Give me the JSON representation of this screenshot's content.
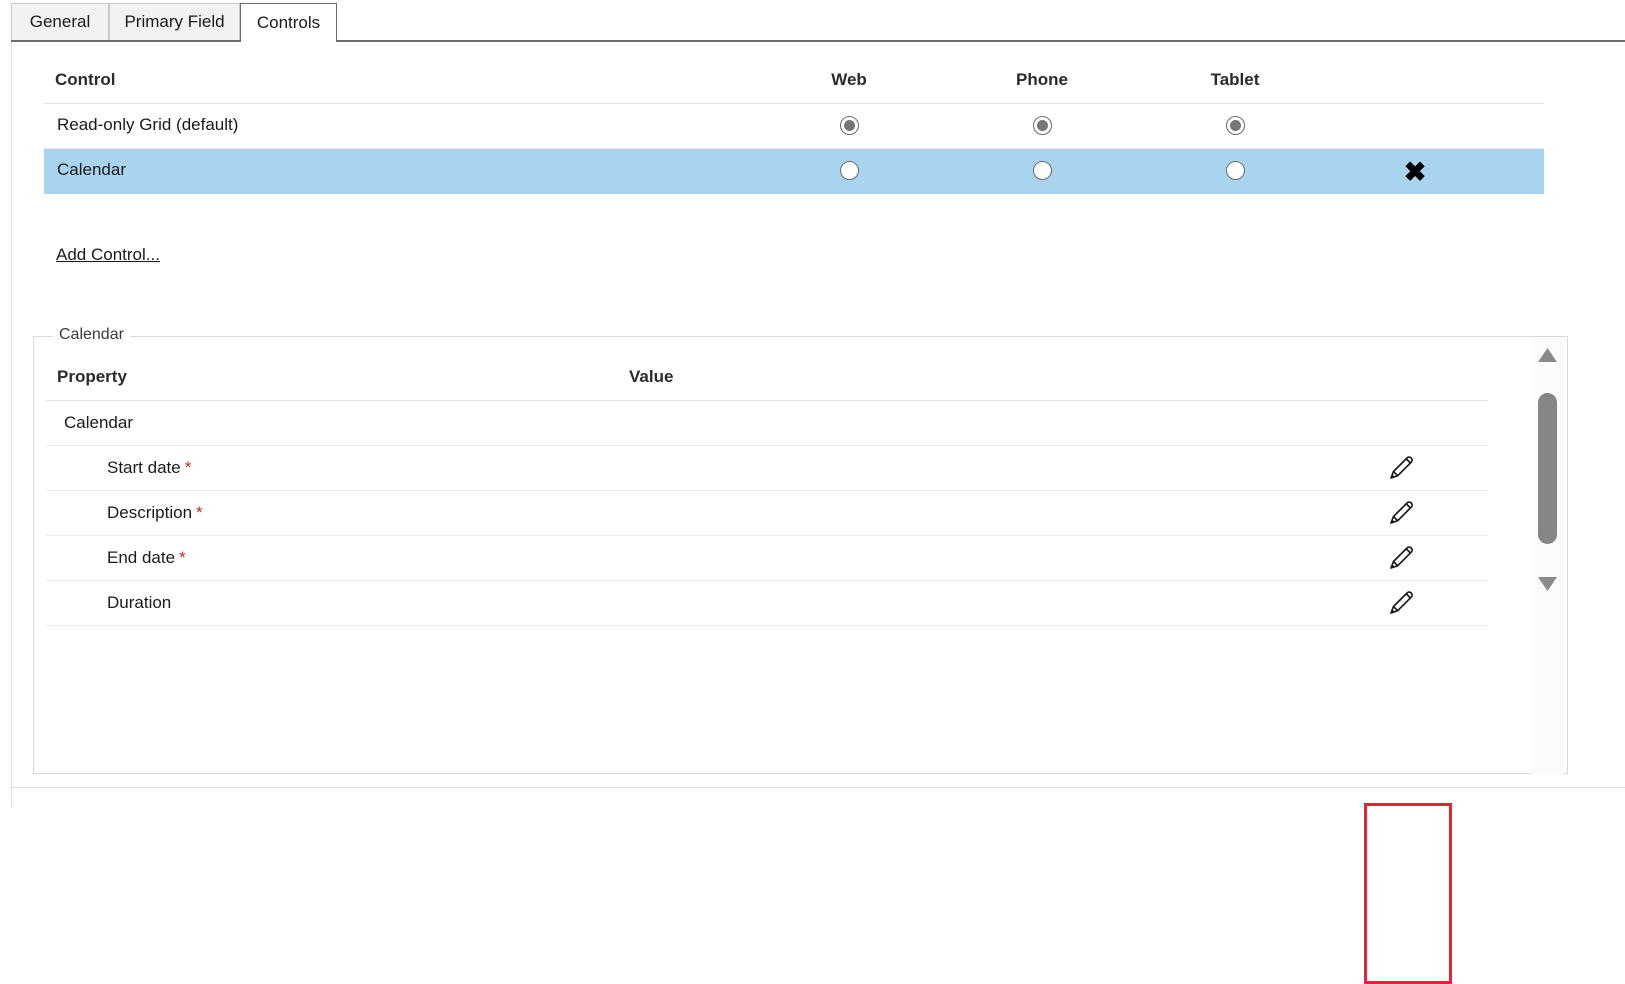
{
  "tabs": [
    {
      "label": "General",
      "active": false
    },
    {
      "label": "Primary Field",
      "active": false
    },
    {
      "label": "Controls",
      "active": true
    }
  ],
  "controls_table": {
    "headers": {
      "control": "Control",
      "web": "Web",
      "phone": "Phone",
      "tablet": "Tablet"
    },
    "rows": [
      {
        "name": "Read-only Grid (default)",
        "web_selected": true,
        "phone_selected": true,
        "tablet_selected": true,
        "highlighted": false,
        "deletable": false
      },
      {
        "name": "Calendar",
        "web_selected": false,
        "phone_selected": false,
        "tablet_selected": false,
        "highlighted": true,
        "deletable": true
      }
    ],
    "add_control_label": "Add Control...",
    "delete_icon": "close-x-icon"
  },
  "properties_panel": {
    "legend": "Calendar",
    "headers": {
      "property": "Property",
      "value": "Value"
    },
    "rows": [
      {
        "name": "Calendar",
        "required": false,
        "indent": 0,
        "value": "",
        "has_edit": false
      },
      {
        "name": "Start date",
        "required": true,
        "indent": 1,
        "value": "",
        "has_edit": true
      },
      {
        "name": "Description",
        "required": true,
        "indent": 1,
        "value": "",
        "has_edit": true
      },
      {
        "name": "End date",
        "required": true,
        "indent": 1,
        "value": "",
        "has_edit": true
      },
      {
        "name": "Duration",
        "required": false,
        "indent": 1,
        "value": "",
        "has_edit": true
      }
    ],
    "required_marker": "*",
    "edit_icon": "pencil-icon",
    "scrollbar": {
      "up_icon": "triangle-up-icon",
      "down_icon": "triangle-down-icon"
    }
  },
  "annotation": {
    "color": "#e8203a",
    "target": "edit-pencil-column"
  },
  "colors": {
    "selected_row": "#a8d4f0",
    "required_star": "#c52b2b",
    "annotation_red": "#e8203a",
    "radio_fill": "#767676",
    "scroll_thumb": "#868686"
  }
}
